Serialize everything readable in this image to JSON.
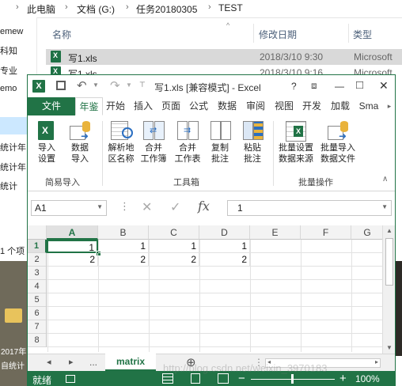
{
  "explorer": {
    "breadcrumb": [
      "此电脑",
      "文档 (G:)",
      "任务20180305",
      "TEST"
    ],
    "columns": {
      "name": "名称",
      "modified": "修改日期",
      "type": "类型"
    },
    "files": [
      {
        "name": "写1.xls",
        "modified": "2018/3/10 9:30",
        "type": "Microsoft"
      },
      {
        "name": "写1.xls",
        "modified": "2018/3/10 9:16",
        "type": "Microsoft"
      }
    ],
    "nav_items": [
      "emew",
      "科知",
      "专业",
      "emo",
      "统计年",
      "统计年",
      "统计",
      "1 个项"
    ],
    "bg_labels": [
      "2017年",
      "自统计"
    ]
  },
  "excel": {
    "title": "写1.xls  [兼容模式] - Excel",
    "title_buttons": {
      "help": "?",
      "minimize": "—",
      "restore": "□",
      "close": "✕"
    },
    "tabs": [
      "文件",
      "年鉴",
      "开始",
      "插入",
      "页面",
      "公式",
      "数据",
      "审阅",
      "视图",
      "开发",
      "加载",
      "Sma"
    ],
    "active_tab": "年鉴",
    "ribbon": {
      "buttons": [
        {
          "l1": "导入",
          "l2": "设置"
        },
        {
          "l1": "数据",
          "l2": "导入"
        },
        {
          "l1": "解析地",
          "l2": "区名称"
        },
        {
          "l1": "合并",
          "l2": "工作簿"
        },
        {
          "l1": "合并",
          "l2": "工作表"
        },
        {
          "l1": "复制",
          "l2": "批注"
        },
        {
          "l1": "粘贴",
          "l2": "批注"
        },
        {
          "l1": "批量设置",
          "l2": "数据来源"
        },
        {
          "l1": "批量导入",
          "l2": "数据文件"
        }
      ],
      "groups": [
        "简易导入",
        "工具箱",
        "批量操作"
      ]
    },
    "formula_bar": {
      "name_box": "A1",
      "fx": "fx",
      "value": "1"
    },
    "columns": [
      "A",
      "B",
      "C",
      "D",
      "E",
      "F",
      "G"
    ],
    "rows": [
      "1",
      "2",
      "3",
      "4",
      "5",
      "6",
      "7",
      "8"
    ],
    "cells": [
      [
        "1",
        "1",
        "1",
        "1"
      ],
      [
        "2",
        "2",
        "2",
        "2"
      ]
    ],
    "sheet_tab": "matrix",
    "sheet_nav": {
      "prev": "◂",
      "next": "▸",
      "more": "...",
      "add": "⊕"
    },
    "status": {
      "mode": "就绪",
      "zoom": "100%"
    },
    "watermark": "http://blog.csdn.net/weixin_3970183"
  }
}
